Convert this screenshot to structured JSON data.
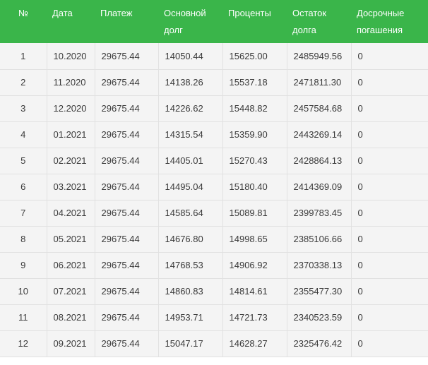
{
  "table": {
    "headers": [
      "№",
      "Дата",
      "Платеж",
      "Основной долг",
      "Проценты",
      "Остаток долга",
      "Досрочные погашения"
    ],
    "rows": [
      [
        "1",
        "10.2020",
        "29675.44",
        "14050.44",
        "15625.00",
        "2485949.56",
        "0"
      ],
      [
        "2",
        "11.2020",
        "29675.44",
        "14138.26",
        "15537.18",
        "2471811.30",
        "0"
      ],
      [
        "3",
        "12.2020",
        "29675.44",
        "14226.62",
        "15448.82",
        "2457584.68",
        "0"
      ],
      [
        "4",
        "01.2021",
        "29675.44",
        "14315.54",
        "15359.90",
        "2443269.14",
        "0"
      ],
      [
        "5",
        "02.2021",
        "29675.44",
        "14405.01",
        "15270.43",
        "2428864.13",
        "0"
      ],
      [
        "6",
        "03.2021",
        "29675.44",
        "14495.04",
        "15180.40",
        "2414369.09",
        "0"
      ],
      [
        "7",
        "04.2021",
        "29675.44",
        "14585.64",
        "15089.81",
        "2399783.45",
        "0"
      ],
      [
        "8",
        "05.2021",
        "29675.44",
        "14676.80",
        "14998.65",
        "2385106.66",
        "0"
      ],
      [
        "9",
        "06.2021",
        "29675.44",
        "14768.53",
        "14906.92",
        "2370338.13",
        "0"
      ],
      [
        "10",
        "07.2021",
        "29675.44",
        "14860.83",
        "14814.61",
        "2355477.30",
        "0"
      ],
      [
        "11",
        "08.2021",
        "29675.44",
        "14953.71",
        "14721.73",
        "2340523.59",
        "0"
      ],
      [
        "12",
        "09.2021",
        "29675.44",
        "15047.17",
        "14628.27",
        "2325476.42",
        "0"
      ]
    ]
  },
  "colors": {
    "header_bg": "#3ab54a",
    "header_text": "#ffffff",
    "row_bg": "#f4f4f4",
    "border": "#e1e1e1"
  }
}
